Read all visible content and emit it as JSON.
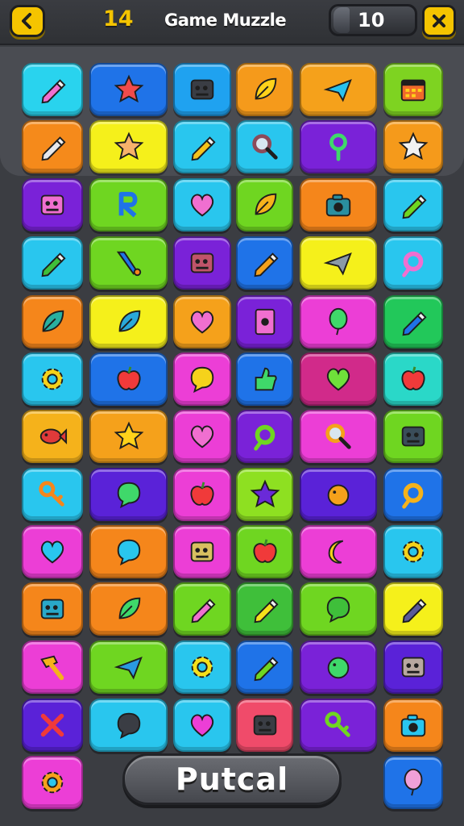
{
  "header": {
    "level": "14",
    "title": "Game Muzzle",
    "counter": "10"
  },
  "board": {
    "tiles": [
      {
        "bg": "#29d3ee",
        "icon": "pencil-icon",
        "fg": "#f06fd0"
      },
      {
        "bg": "#1f73e8",
        "icon": "star-icon",
        "fg": "#f04b4b"
      },
      {
        "bg": "#1fa2f0",
        "icon": "chip-icon",
        "fg": "#3a3d44"
      },
      {
        "bg": "#f59a1b",
        "icon": "leaf-icon",
        "fg": "#ffd21a"
      },
      {
        "bg": "#f5a11b",
        "icon": "plane-icon",
        "fg": "#28c2ee"
      },
      {
        "bg": "#7ed321",
        "icon": "calendar-icon",
        "fg": "#f06a2a"
      },
      {
        "bg": "#f58a1b",
        "icon": "pencil-icon",
        "fg": "#e6e8ec"
      },
      {
        "bg": "#f5f01b",
        "icon": "star-icon",
        "fg": "#f7b26b"
      },
      {
        "bg": "#29c6ee",
        "icon": "pencil-icon",
        "fg": "#f5c21b"
      },
      {
        "bg": "#29c6ee",
        "icon": "search-icon",
        "fg": "#8b4b5a"
      },
      {
        "bg": "#7a22d8",
        "icon": "pin-icon",
        "fg": "#3fd86a"
      },
      {
        "bg": "#f59a1b",
        "icon": "star-icon",
        "fg": "#f2f2f2"
      },
      {
        "bg": "#7a22d8",
        "icon": "chip-icon",
        "fg": "#f06fd0"
      },
      {
        "bg": "#6fd621",
        "icon": "letter-icon",
        "fg": "#1f73e8"
      },
      {
        "bg": "#29c6ee",
        "icon": "heart-icon",
        "fg": "#f06fd0"
      },
      {
        "bg": "#6fd621",
        "icon": "leaf-icon",
        "fg": "#f5b21b"
      },
      {
        "bg": "#f5861b",
        "icon": "camera-icon",
        "fg": "#2a8fa0"
      },
      {
        "bg": "#29c6ee",
        "icon": "pencil-icon",
        "fg": "#6fd621"
      },
      {
        "bg": "#29c6ee",
        "icon": "pencil-icon",
        "fg": "#3fbf3a"
      },
      {
        "bg": "#6fd621",
        "icon": "brush-icon",
        "fg": "#1f73e8"
      },
      {
        "bg": "#7a22d8",
        "icon": "chip-icon",
        "fg": "#c0546a"
      },
      {
        "bg": "#1f73e8",
        "icon": "pencil-icon",
        "fg": "#f5a11b"
      },
      {
        "bg": "#f5f01b",
        "icon": "plane-icon",
        "fg": "#8a9aa8"
      },
      {
        "bg": "#29c6ee",
        "icon": "ring-icon",
        "fg": "#f06fd0"
      },
      {
        "bg": "#f5861b",
        "icon": "leaf-icon",
        "fg": "#2ab0a0"
      },
      {
        "bg": "#f5f01b",
        "icon": "leaf-icon",
        "fg": "#2aa8d8"
      },
      {
        "bg": "#f5a11b",
        "icon": "heart-icon",
        "fg": "#f06fd0"
      },
      {
        "bg": "#7a22d8",
        "icon": "card-icon",
        "fg": "#f06fd0"
      },
      {
        "bg": "#ec3ed6",
        "icon": "balloon-icon",
        "fg": "#3fd86a"
      },
      {
        "bg": "#22c85a",
        "icon": "pencil-icon",
        "fg": "#1f73e8"
      },
      {
        "bg": "#29c6ee",
        "icon": "gear-icon",
        "fg": "#f5d21b"
      },
      {
        "bg": "#1f73e8",
        "icon": "apple-icon",
        "fg": "#f03a3a"
      },
      {
        "bg": "#ec3ed6",
        "icon": "chat-icon",
        "fg": "#f5d21b"
      },
      {
        "bg": "#1f73e8",
        "icon": "thumb-icon",
        "fg": "#3fd86a"
      },
      {
        "bg": "#d12a8a",
        "icon": "heart-icon",
        "fg": "#6fe03a"
      },
      {
        "bg": "#2ad8c8",
        "icon": "apple-icon",
        "fg": "#f03a3a"
      },
      {
        "bg": "#f5b21b",
        "icon": "fish-icon",
        "fg": "#e03a3a"
      },
      {
        "bg": "#f5a11b",
        "icon": "star-icon",
        "fg": "#ffd21a"
      },
      {
        "bg": "#ec3ed6",
        "icon": "heart-icon",
        "fg": "#f06fd0"
      },
      {
        "bg": "#7a22d8",
        "icon": "ring-icon",
        "fg": "#6fd621"
      },
      {
        "bg": "#ec3ed6",
        "icon": "search-icon",
        "fg": "#f5a11b"
      },
      {
        "bg": "#6fd621",
        "icon": "chip-icon",
        "fg": "#3a4d5a"
      },
      {
        "bg": "#29c6ee",
        "icon": "key-icon",
        "fg": "#f5861b"
      },
      {
        "bg": "#5a22d8",
        "icon": "chat-icon",
        "fg": "#3fd86a"
      },
      {
        "bg": "#ec3ed6",
        "icon": "apple-icon",
        "fg": "#f03a3a"
      },
      {
        "bg": "#8ee021",
        "icon": "star-icon",
        "fg": "#6a2ad8"
      },
      {
        "bg": "#5a22d8",
        "icon": "orange-icon",
        "fg": "#f5a11b"
      },
      {
        "bg": "#1f73e8",
        "icon": "ring-icon",
        "fg": "#f5b21b"
      },
      {
        "bg": "#ec3ed6",
        "icon": "heart-icon",
        "fg": "#29c6ee"
      },
      {
        "bg": "#f5861b",
        "icon": "chat-icon",
        "fg": "#29c6ee"
      },
      {
        "bg": "#ec3ed6",
        "icon": "chip-icon",
        "fg": "#d8c060"
      },
      {
        "bg": "#6fd621",
        "icon": "apple-icon",
        "fg": "#f03a3a"
      },
      {
        "bg": "#ec3ed6",
        "icon": "moon-icon",
        "fg": "#f5d21b"
      },
      {
        "bg": "#29c6ee",
        "icon": "gear-icon",
        "fg": "#f5d21b"
      },
      {
        "bg": "#f5861b",
        "icon": "chip-icon",
        "fg": "#29a8c8"
      },
      {
        "bg": "#f5861b",
        "icon": "leaf-icon",
        "fg": "#3fd86a"
      },
      {
        "bg": "#6fd621",
        "icon": "pencil-icon",
        "fg": "#f06fd0"
      },
      {
        "bg": "#3fbf3a",
        "icon": "pencil-icon",
        "fg": "#f5e01b"
      },
      {
        "bg": "#6fd621",
        "icon": "chat-icon",
        "fg": "#3fbf3a"
      },
      {
        "bg": "#f5f01b",
        "icon": "pencil-icon",
        "fg": "#5a5a9a"
      },
      {
        "bg": "#ec3ed6",
        "icon": "hammer-icon",
        "fg": "#f5b21b"
      },
      {
        "bg": "#6fd621",
        "icon": "plane-icon",
        "fg": "#2a9ae0"
      },
      {
        "bg": "#29c6ee",
        "icon": "gear-icon",
        "fg": "#f5e01b"
      },
      {
        "bg": "#1f73e8",
        "icon": "pencil-icon",
        "fg": "#6fd621"
      },
      {
        "bg": "#7a22d8",
        "icon": "orange-icon",
        "fg": "#3fd86a"
      },
      {
        "bg": "#5a22d8",
        "icon": "chip-icon",
        "fg": "#b8a8a0"
      },
      {
        "bg": "#5a22d8",
        "icon": "cross-icon",
        "fg": "#f03a3a"
      },
      {
        "bg": "#29c6ee",
        "icon": "chat-icon",
        "fg": "#3a3d44"
      },
      {
        "bg": "#29c6ee",
        "icon": "heart-icon",
        "fg": "#ec3ed6"
      },
      {
        "bg": "#f04b6a",
        "icon": "chip-icon",
        "fg": "#3a3d44"
      },
      {
        "bg": "#7a22d8",
        "icon": "key-icon",
        "fg": "#6fd621"
      },
      {
        "bg": "#f5861b",
        "icon": "camera-icon",
        "fg": "#29c6ee"
      },
      {
        "bg": "#ec3ed6",
        "icon": "gear-icon",
        "fg": "#f5a11b"
      },
      {
        "bg": "#1f73e8",
        "icon": "balloon-icon",
        "fg": "#f0a0d8"
      }
    ]
  },
  "footer": {
    "action_label": "Putcal"
  }
}
